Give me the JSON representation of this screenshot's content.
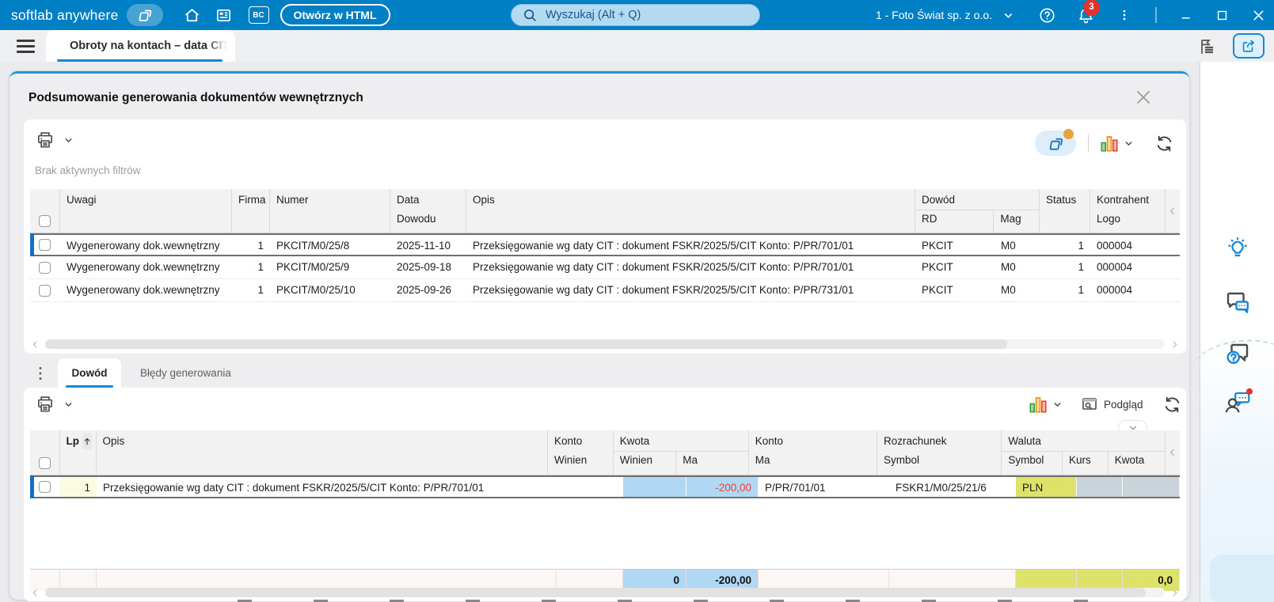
{
  "topbar": {
    "brand": "softlab anywhere",
    "bc_label": "BC",
    "open_html_label": "Otwórz w HTML",
    "search_placeholder": "Wyszukaj (Alt + Q)",
    "company": "1 - Foto Świat sp. z o.o.",
    "notification_count": "3"
  },
  "tabrow": {
    "main_tab": "Obroty na kontach – data CIT"
  },
  "panel": {
    "title": "Podsumowanie generowania dokumentów wewnętrznych",
    "filters_status": "Brak aktywnych filtrów"
  },
  "table1": {
    "headers": {
      "uwagi": "Uwagi",
      "firma": "Firma",
      "numer": "Numer",
      "data_l1": "Data",
      "data_l2": "Dowodu",
      "opis": "Opis",
      "dowod": "Dowód",
      "rd": "RD",
      "mag": "Mag",
      "status": "Status",
      "kontrahent_l1": "Kontrahent",
      "kontrahent_l2": "Logo"
    },
    "rows": [
      {
        "uwagi": "Wygenerowany dok.wewnętrzny",
        "firma": "1",
        "numer": "PKCIT/M0/25/8",
        "data": "2025-11-10",
        "opis": "Przeksięgowanie wg daty CIT : dokument FSKR/2025/5/CIT Konto: P/PR/701/01",
        "rd": "PKCIT",
        "mag": "M0",
        "status": "1",
        "logo": "000004"
      },
      {
        "uwagi": "Wygenerowany dok.wewnętrzny",
        "firma": "1",
        "numer": "PKCIT/M0/25/9",
        "data": "2025-09-18",
        "opis": "Przeksięgowanie wg daty CIT : dokument FSKR/2025/5/CIT Konto: P/PR/701/01",
        "rd": "PKCIT",
        "mag": "M0",
        "status": "1",
        "logo": "000004"
      },
      {
        "uwagi": "Wygenerowany dok.wewnętrzny",
        "firma": "1",
        "numer": "PKCIT/M0/25/10",
        "data": "2025-09-26",
        "opis": "Przeksięgowanie wg daty CIT : dokument FSKR/2025/5/CIT Konto: P/PR/731/01",
        "rd": "PKCIT",
        "mag": "M0",
        "status": "1",
        "logo": "000004"
      }
    ]
  },
  "subtabs": {
    "dowod": "Dowód",
    "bledy": "Błędy generowania"
  },
  "toolbar2": {
    "preview_label": "Podgląd"
  },
  "table2": {
    "headers": {
      "lp": "Lp",
      "opis": "Opis",
      "konto_w_l1": "Konto",
      "konto_w_l2": "Winien",
      "kwota_group": "Kwota",
      "kwota_winien": "Winien",
      "kwota_ma": "Ma",
      "konto_m_l1": "Konto",
      "konto_m_l2": "Ma",
      "rozrachunek_l1": "Rozrachunek",
      "rozrachunek_l2": "Symbol",
      "waluta_group": "Waluta",
      "waluta_symbol": "Symbol",
      "kurs": "Kurs",
      "kwota": "Kwota"
    },
    "row": {
      "lp": "1",
      "opis": "Przeksięgowanie wg daty CIT : dokument FSKR/2025/5/CIT Konto: P/PR/701/01",
      "kwota_ma": "-200,00",
      "konto_ma": "P/PR/701/01",
      "rozrachunek": "FSKR1/M0/25/21/6",
      "waluta": "PLN"
    },
    "summary": {
      "kwota_winien": "0",
      "kwota_ma": "-200,00",
      "kwota": "0,0"
    }
  },
  "colors": {
    "topbar_blue": "#0080c4",
    "accent_blue": "#1788d4",
    "negative_red": "#e8443a",
    "cell_blue": "#b0d7f3",
    "cell_yellow_green": "#dde26a",
    "cell_gray_blue": "#c9d3da",
    "badge_red": "#e0332c"
  }
}
